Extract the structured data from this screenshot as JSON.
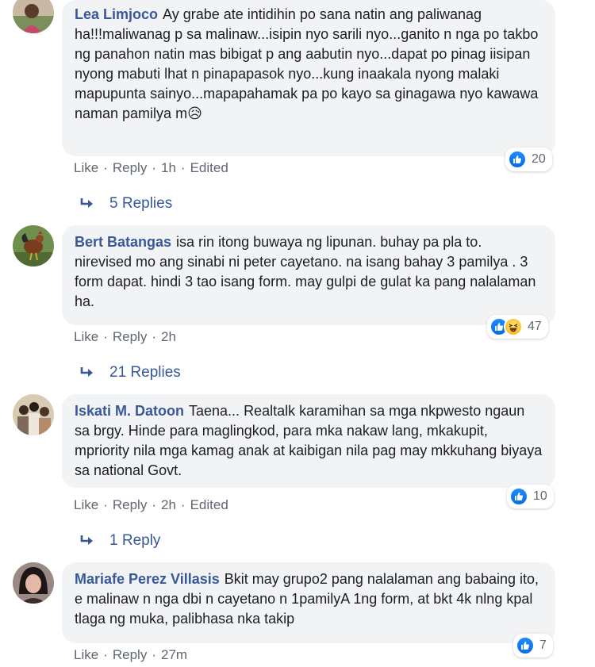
{
  "colors": {
    "link": "#385898",
    "meta": "#606770",
    "bubble": "#f2f3f5",
    "like_blue": "#1877f2"
  },
  "comments": [
    {
      "author": "Lea Limjoco",
      "text": "Ay grabe ate intidihin po sana natin ang paliwanag ha!!!maliwanag p sa malinaw...isipin nyo sarili nyo...ganito n nga po takbo ng panahon natin mas bibigat p ang aabutin nyo...dapat po pinag iisipan nyong mabuti lhat n pinapapasok nyo...kung inaakala nyong malaki mapupunta sainyo...mapapahamak pa po kayo sa ginagawa nyo kawawa naman pamilya m",
      "emoji": "😥",
      "reactions": {
        "icons": [
          "like-icon"
        ],
        "count": "20"
      },
      "actions": {
        "like": "Like",
        "reply": "Reply",
        "time": "1h",
        "edited": "Edited"
      },
      "replies_label": "5 Replies"
    },
    {
      "author": "Bert Batangas",
      "text": "isa rin itong buwaya ng lipunan. buhay pa pla to. nirevised mo ang sinabi ni peter cayetano. na isang bahay 3 pamilya . 3 form dapat. hindi 3 tao isang form. may gulpi de gulat ka pang nalalaman ha.",
      "reactions": {
        "icons": [
          "like-icon",
          "haha-icon"
        ],
        "count": "47"
      },
      "actions": {
        "like": "Like",
        "reply": "Reply",
        "time": "2h"
      },
      "replies_label": "21 Replies"
    },
    {
      "author": "Iskati M. Datoon",
      "text": "Taena... Realtalk karamihan sa mga nkpwesto ngaun sa brgy. Hinde para maglingkod, para mka nakaw lang, mkakupit, mpriority nila mga kamag anak at kaibigan nila pag may mkkuhang biyaya sa national Govt.",
      "reactions": {
        "icons": [
          "like-icon"
        ],
        "count": "10"
      },
      "actions": {
        "like": "Like",
        "reply": "Reply",
        "time": "2h",
        "edited": "Edited"
      },
      "replies_label": "1 Reply"
    },
    {
      "author": "Mariafe Perez Villasis",
      "text": "Bkit may grupo2 pang nalalaman ang babaing ito, e malinaw n nga dbi n cayetano n 1pamilyA 1ng form, at bkt 4k nlng kpal tlaga ng muka, palibhasa nka takip",
      "reactions": {
        "icons": [
          "like-icon"
        ],
        "count": "7"
      },
      "actions": {
        "like": "Like",
        "reply": "Reply",
        "time": "27m"
      }
    }
  ]
}
